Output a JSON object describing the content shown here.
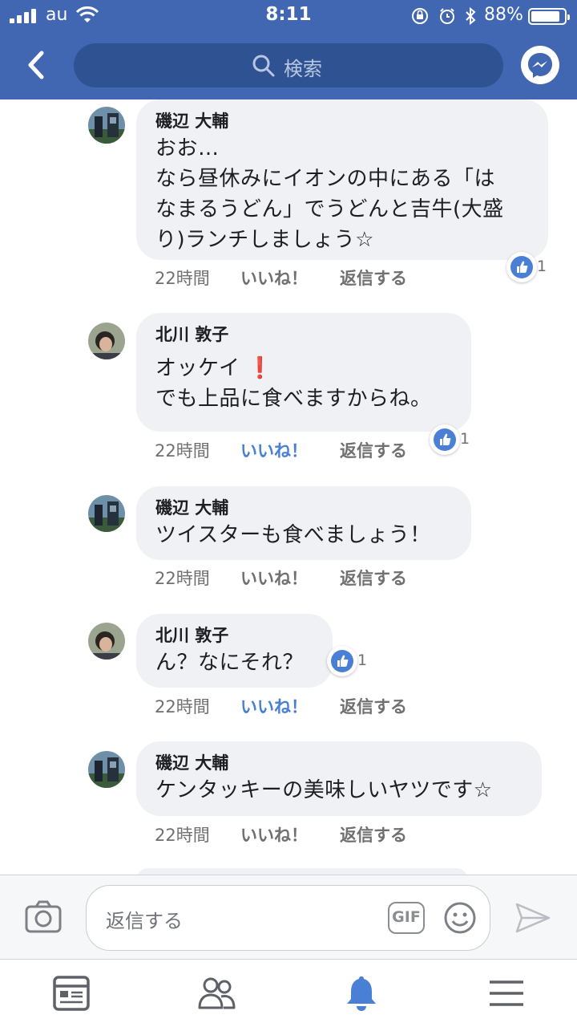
{
  "status_bar": {
    "carrier": "au",
    "time": "8:11",
    "battery_text": "88%",
    "battery_level": 0.88
  },
  "header": {
    "search_placeholder": "検索",
    "icons": [
      "back-arrow-icon",
      "search-icon",
      "messenger-icon"
    ]
  },
  "comments": [
    {
      "author": "磯辺 大輔",
      "lines": [
        "おお…",
        "なら昼休みにイオンの中にある「は",
        "なまるうどん」でうどんと吉牛(大盛",
        "り)ランチしましょう☆"
      ],
      "time": "22時間",
      "like_label": "いいね！",
      "reply_label": "返信する",
      "liked": false,
      "reaction_count": "1"
    },
    {
      "author": "北川 敦子",
      "lines": [
        "オッケイ",
        "でも上品に食べますからね。"
      ],
      "emoji": "❗",
      "time": "22時間",
      "like_label": "いいね！",
      "reply_label": "返信する",
      "liked": true,
      "reaction_count": "1"
    },
    {
      "author": "磯辺 大輔",
      "lines": [
        "ツイスターも食べましょう！"
      ],
      "time": "22時間",
      "like_label": "いいね！",
      "reply_label": "返信する",
      "liked": false
    },
    {
      "author": "北川 敦子",
      "lines": [
        "ん？なにそれ？"
      ],
      "time": "22時間",
      "like_label": "いいね！",
      "reply_label": "返信する",
      "liked": true,
      "reaction_count": "1"
    },
    {
      "author": "磯辺 大輔",
      "lines": [
        "ケンタッキーの美味しいヤツです☆"
      ],
      "time": "22時間",
      "like_label": "いいね！",
      "reply_label": "返信する",
      "liked": false
    }
  ],
  "reply_bar": {
    "placeholder": "返信する",
    "gif_label": "GIF"
  },
  "tabs": [
    {
      "name": "news-feed",
      "icon": "newsfeed-icon",
      "active": false
    },
    {
      "name": "friends",
      "icon": "friends-icon",
      "active": false
    },
    {
      "name": "notifications",
      "icon": "bell-icon",
      "active": true
    },
    {
      "name": "menu",
      "icon": "hamburger-menu-icon",
      "active": false
    }
  ],
  "colors": {
    "brand_blue": "#4267b2",
    "search_bg": "#2f5293",
    "like_blue": "#4a7fd6",
    "bubble_bg": "#f0f1f4",
    "exclaim_red": "#e3202c"
  }
}
